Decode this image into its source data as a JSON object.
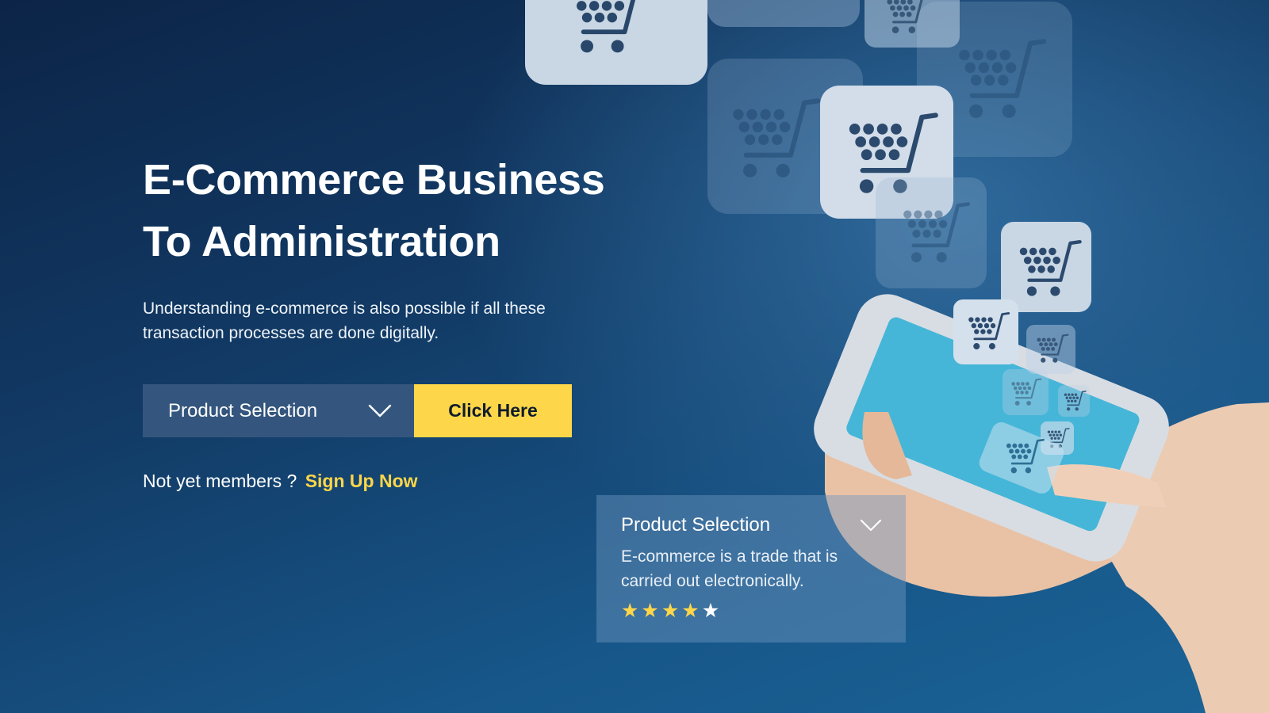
{
  "hero": {
    "title_line1": "E-Commerce Business",
    "title_line2": "To Administration",
    "description": "Understanding e-commerce is also possible if all these transaction processes are done digitally."
  },
  "dropdown": {
    "label": "Product Selection",
    "icon": "chevron-down-icon"
  },
  "cta": {
    "label": "Click Here"
  },
  "signup": {
    "prompt": "Not yet members ?",
    "link_label": "Sign Up Now"
  },
  "product_card": {
    "title": "Product Selection",
    "description": "E-commerce is a trade that is carried out electronically.",
    "rating": 4,
    "rating_max": 5,
    "stars": [
      "★",
      "★",
      "★",
      "★",
      "★"
    ]
  },
  "illustration": {
    "tile_icon": "shopping-cart-icon",
    "subject": "hand-holding-smartphone"
  },
  "colors": {
    "accent": "#fdd649",
    "dropdown_bg": "#34567e",
    "background_dark": "#0c2447",
    "background_light": "#1b6496"
  }
}
